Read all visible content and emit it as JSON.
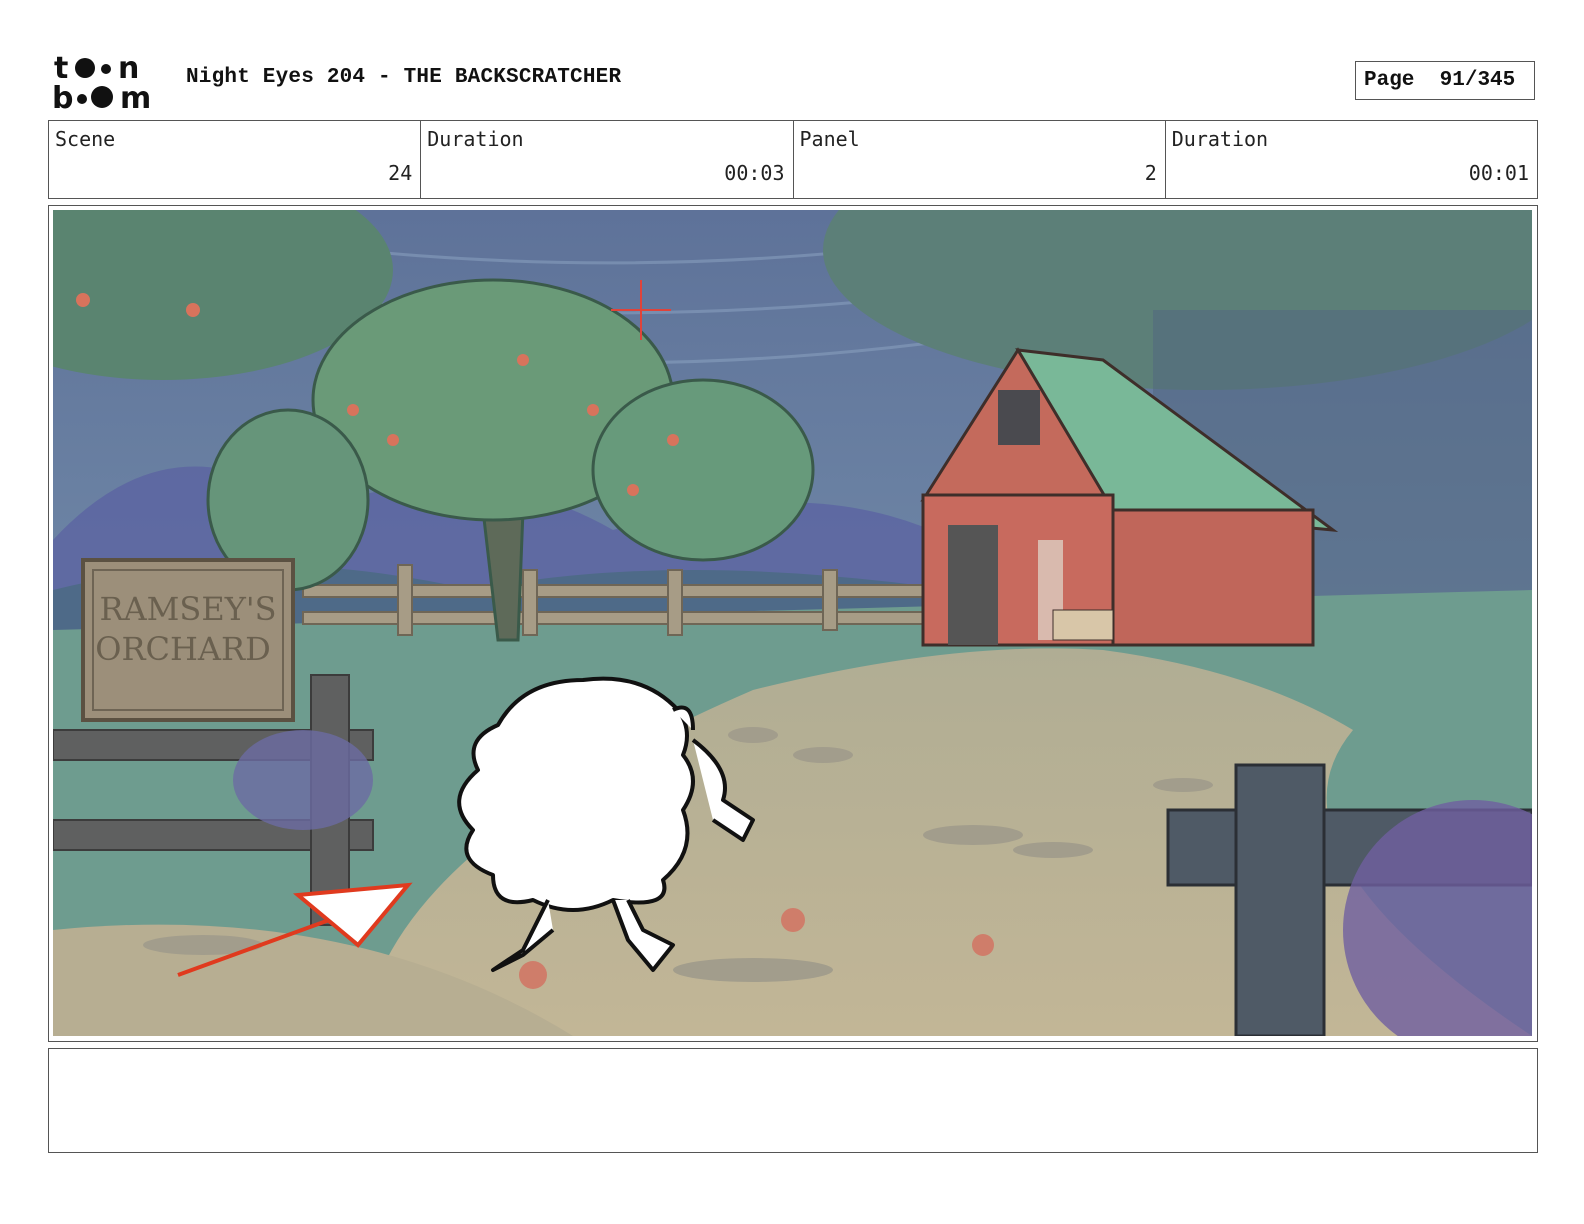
{
  "header": {
    "logo_text": "toon boom",
    "title": "Night Eyes 204 - THE BACKSCRATCHER",
    "page_label": "Page",
    "page_value": "91/345"
  },
  "info": {
    "scene_label": "Scene",
    "scene_value": "24",
    "scene_duration_label": "Duration",
    "scene_duration_value": "00:03",
    "panel_label": "Panel",
    "panel_value": "2",
    "panel_duration_label": "Duration",
    "panel_duration_value": "00:01"
  },
  "panel": {
    "sign_line1": "RAMSEY'S",
    "sign_line2": "ORCHARD",
    "colors": {
      "sky": "#6a83a6",
      "foliage": "#5d8a72",
      "barn": "#c0645a",
      "path": "#b9b090",
      "grass": "#6f9a8e",
      "annotation": "#e03a1e"
    }
  },
  "notes": {
    "text": ""
  }
}
